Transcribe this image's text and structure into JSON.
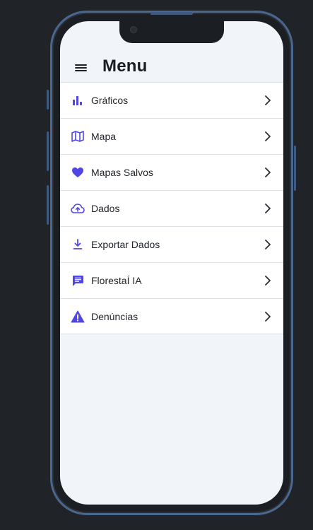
{
  "header": {
    "title": "Menu"
  },
  "menu": {
    "items": [
      {
        "label": "Gráficos",
        "icon": "bar-chart-icon"
      },
      {
        "label": "Mapa",
        "icon": "map-icon"
      },
      {
        "label": "Mapas Salvos",
        "icon": "heart-icon"
      },
      {
        "label": "Dados",
        "icon": "cloud-upload-icon"
      },
      {
        "label": "Exportar Dados",
        "icon": "download-icon"
      },
      {
        "label": "FlorestaÍ IA",
        "icon": "chat-icon"
      },
      {
        "label": "Denúncias",
        "icon": "warning-icon"
      }
    ]
  },
  "colors": {
    "accent": "#4f46e5",
    "background": "#f1f4f8",
    "frame": "#4a6790"
  }
}
